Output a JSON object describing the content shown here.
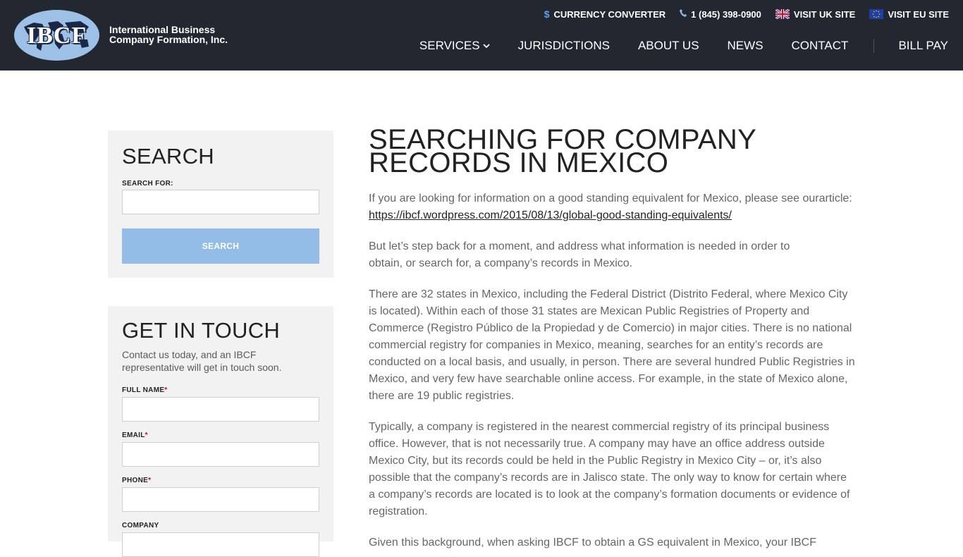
{
  "header": {
    "logo_text": "IBCF",
    "company_name_line1": "International Business",
    "company_name_line2": "Company Formation, Inc.",
    "topbar": {
      "currency": "CURRENCY CONVERTER",
      "phone": "1 (845) 398-0900",
      "uk": "VISIT UK SITE",
      "eu": "VISIT EU SITE"
    },
    "nav": [
      "SERVICES",
      "JURISDICTIONS",
      "ABOUT US",
      "NEWS",
      "CONTACT",
      "BILL PAY"
    ],
    "icons": {
      "dollar": "dollar-icon",
      "phone": "phone-icon",
      "uk_flag": "uk-flag-icon",
      "eu_flag": "eu-flag-icon",
      "chevron": "chevron-down-icon"
    }
  },
  "sidebar": {
    "search": {
      "title": "SEARCH",
      "label": "SEARCH FOR:",
      "value": "",
      "button": "SEARCH"
    },
    "touch": {
      "title": "GET IN TOUCH",
      "description": "Contact us today, and an IBCF representative will get in touch soon.",
      "fields": [
        {
          "label": "FULL NAME",
          "required": "*",
          "value": ""
        },
        {
          "label": "EMAIL",
          "required": "*",
          "value": ""
        },
        {
          "label": "PHONE",
          "required": "*",
          "value": ""
        },
        {
          "label": "COMPANY",
          "required": "",
          "value": ""
        }
      ]
    }
  },
  "article": {
    "title_line1": "SEARCHING FOR COMPANY",
    "title_line2": "RECORDS IN MEXICO",
    "p1_text": "If you are looking for information on a good standing equivalent for Mexico, please see ourarticle: ",
    "p1_link": "https://ibcf.wordpress.com/2015/08/13/global-good-standing-equivalents/",
    "p2": "But let’s step back for a moment, and address what information is needed in order to obtain, or search for, a company’s records in Mexico.",
    "p3": "There are 32 states in Mexico, including the Federal District (Distrito Federal, where Mexico City is located). Within each of those 31 states are Mexican Public Registries of Property and Commerce (Registro Público de la Propiedad y de Comercio) in major cities. There is no national commercial registry for companies in Mexico, meaning, searches for an entity’s records are conducted on a local basis, and usually, in person. There are several hundred Public Registries in Mexico, and very few have searchable online access. For example, in the state of Mexico alone, there are 19 public registries.",
    "p4": "Typically, a company is registered in the nearest commercial registry of its principal business office. However, that is not necessarily true. A company may have an office address outside Mexico City, but its records could be held in the Public Registry in Mexico City – or, it’s also possible that the company’s records are in Jalisco state. The only way to know for certain where a company’s records are located is to look at the company’s formation documents or evidence of registration.",
    "p5": "Given this background, when asking IBCF to obtain a GS equivalent in Mexico, your IBCF"
  }
}
